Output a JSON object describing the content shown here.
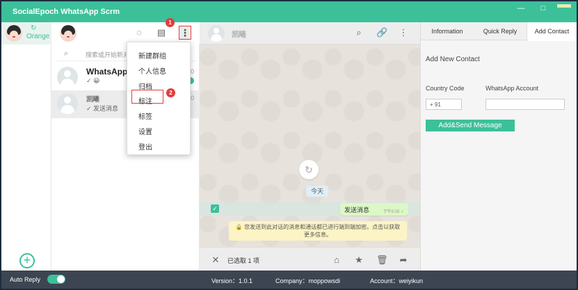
{
  "app": {
    "title": "SocialEpoch WhatsApp Scrm",
    "window_controls": [
      "—",
      "□"
    ]
  },
  "account_sidebar": {
    "refresh_icon": "↻",
    "account_name": "Orange",
    "add_icon": "+"
  },
  "chat_list": {
    "search_placeholder": "搜索或开始新对",
    "search_icon": "⌕",
    "header_icons": {
      "status": "◌",
      "chat": "▤",
      "menu": "⋮"
    },
    "menu_badge": "1",
    "items": [
      {
        "name": "WhatsAppS",
        "preview": "✓ 😀",
        "time": "0",
        "unread": true
      },
      {
        "name": "凯曦",
        "preview": "✓ 发送消息",
        "time": "0",
        "selected": true
      }
    ]
  },
  "dropdown_menu": {
    "items": [
      "新建群组",
      "个人信息",
      "归档",
      "标注",
      "标签",
      "设置",
      "登出"
    ],
    "highlight_badge": "2",
    "highlighted_item": "标注"
  },
  "conversation": {
    "contact_name": "凯曦",
    "header_icons": {
      "search": "⌕",
      "attach": "🔗",
      "menu": "⋮"
    },
    "loader_icon": "↻",
    "day_label": "今天",
    "checkbox_icon": "✓",
    "outgoing_message": "发送消息",
    "outgoing_time": "下午5:05 ✓",
    "encryption_note": "🔒 您发送到此对话的消息和通话都已进行端到端加密。点击以获取更多信息。",
    "footer": {
      "close_icon": "✕",
      "selected_text": "已选取 1 项",
      "label_icon": "⌂",
      "star_icon": "★",
      "delete_icon": "🗑",
      "forward_icon": "➦"
    }
  },
  "right_panel": {
    "tabs": [
      "Information",
      "Quick Reply",
      "Add Contact"
    ],
    "active_tab": "Add Contact",
    "title": "Add New Contact",
    "country_code_label": "Country Code",
    "whatsapp_account_label": "WhatsApp Account",
    "country_code_value": "+ 91",
    "whatsapp_account_value": "",
    "submit_label": "Add&Send Message"
  },
  "status_bar": {
    "auto_reply_label": "Auto Reply",
    "auto_reply_on": true,
    "version": "Version：1.0.1",
    "company": "Company：moppowsdi",
    "account": "Account：weiyikun"
  },
  "colors": {
    "accent": "#3cc09a",
    "status_bar": "#3c4551",
    "annotation": "#e23c3c"
  }
}
